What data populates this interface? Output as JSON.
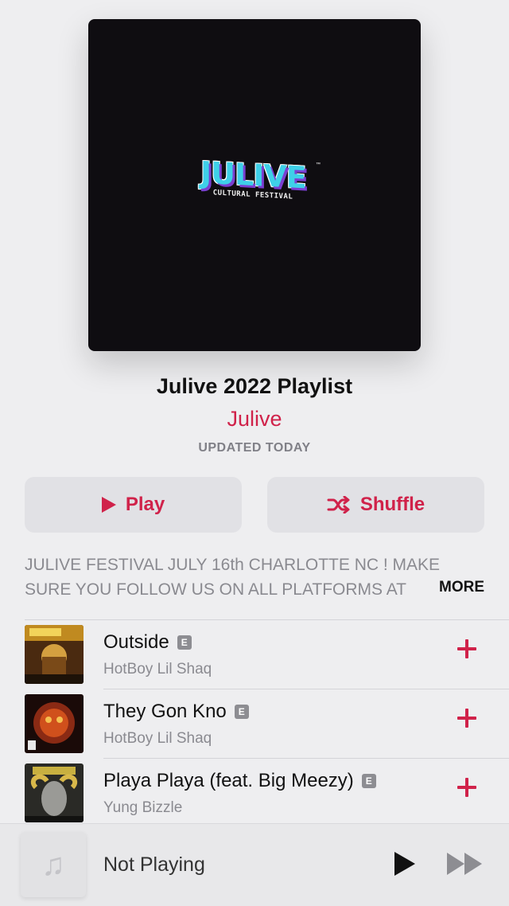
{
  "artwork": {
    "logo_text": "JULIVE",
    "logo_tm": "™",
    "logo_subtitle": "CULTURAL FESTIVAL"
  },
  "playlist": {
    "title": "Julive 2022 Playlist",
    "curator": "Julive",
    "updated": "UPDATED TODAY"
  },
  "actions": {
    "play_label": "Play",
    "shuffle_label": "Shuffle",
    "play_icon": "play-icon",
    "shuffle_icon": "shuffle-icon"
  },
  "description": {
    "line1": "JULIVE FESTIVAL JULY 16th CHARLOTTE NC ! MAKE",
    "line2": "SURE YOU FOLLOW US ON ALL PLATFORMS AT",
    "more_label": "MORE"
  },
  "tracks": [
    {
      "title": "Outside",
      "explicit": "E",
      "artist": "HotBoy Lil Shaq"
    },
    {
      "title": "They Gon Kno",
      "explicit": "E",
      "artist": "HotBoy Lil Shaq"
    },
    {
      "title": "Playa Playa (feat. Big Meezy)",
      "explicit": "E",
      "artist": "Yung Bizzle"
    }
  ],
  "mini_player": {
    "status": "Not Playing",
    "artwork_icon": "music-note-icon",
    "play_icon": "play-icon",
    "forward_icon": "fast-forward-icon"
  },
  "colors": {
    "accent": "#d0224a",
    "background": "#eeeef0"
  }
}
